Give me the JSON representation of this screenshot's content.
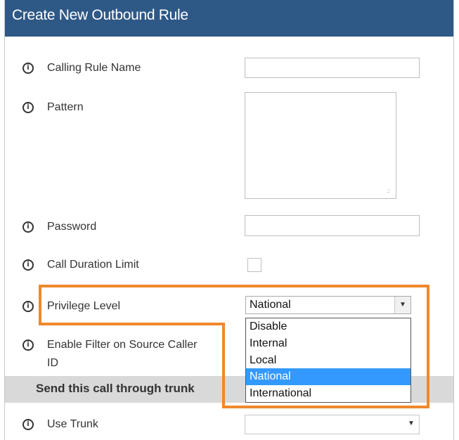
{
  "dialog": {
    "title": "Create New Outbound Rule"
  },
  "fields": {
    "calling_rule_name": {
      "label": "Calling Rule Name",
      "value": ""
    },
    "pattern": {
      "label": "Pattern",
      "value": ""
    },
    "password": {
      "label": "Password",
      "value": ""
    },
    "call_duration_limit": {
      "label": "Call Duration Limit",
      "checked": false
    },
    "privilege_level": {
      "label": "Privilege Level",
      "selected": "National",
      "options": [
        "Disable",
        "Internal",
        "Local",
        "National",
        "International"
      ]
    },
    "enable_filter": {
      "label_line1": "Enable Filter on Source Caller",
      "label_line2": "ID"
    },
    "use_trunk": {
      "label": "Use Trunk",
      "selected": ""
    }
  },
  "trunk_section": {
    "heading": "Send this call through trunk"
  },
  "icons": {
    "info_glyph": "i",
    "dropdown_arrow": "▼",
    "resize_grip": ".::"
  },
  "colors": {
    "title_bar": "#2e5886",
    "highlight_outline": "#f0882d",
    "selected_option": "#3399ff",
    "section_banner": "#d9d9d9"
  }
}
